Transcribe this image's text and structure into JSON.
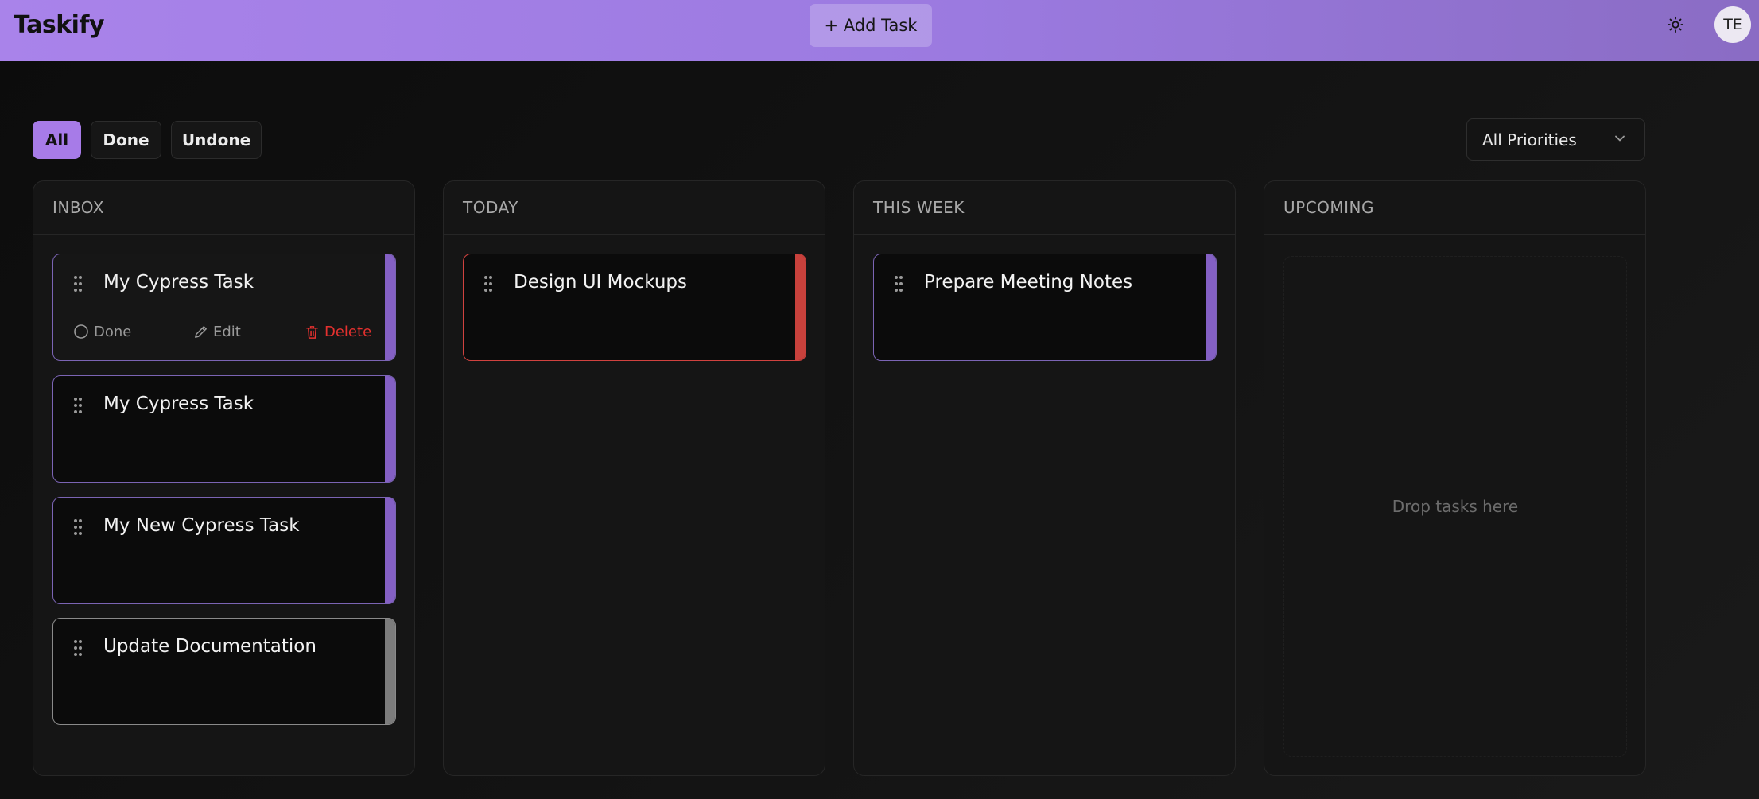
{
  "header": {
    "brand": "Taskify",
    "add_task_label": "+ Add Task",
    "avatar_initials": "TE",
    "theme_icon": "sun-icon"
  },
  "filters": {
    "items": [
      {
        "label": "All",
        "active": true
      },
      {
        "label": "Done",
        "active": false
      },
      {
        "label": "Undone",
        "active": false
      }
    ],
    "priority_select": {
      "selected": "All Priorities",
      "icon": "chevron-down-icon"
    }
  },
  "columns": [
    {
      "title": "INBOX",
      "cards": [
        {
          "title": "My Cypress Task",
          "accent": "#8460c4",
          "expanded": true,
          "actions": {
            "done": "Done",
            "edit": "Edit",
            "delete": "Delete"
          }
        },
        {
          "title": "My Cypress Task",
          "accent": "#8460c4"
        },
        {
          "title": "My New Cypress Task",
          "accent": "#8460c4"
        },
        {
          "title": "Update Documentation",
          "accent": "#7c7c7c"
        }
      ]
    },
    {
      "title": "TODAY",
      "cards": [
        {
          "title": "Design UI Mockups",
          "accent": "#c8413c"
        }
      ]
    },
    {
      "title": "THIS WEEK",
      "cards": [
        {
          "title": "Prepare Meeting Notes",
          "accent": "#8460c4"
        }
      ]
    },
    {
      "title": "UPCOMING",
      "cards": [],
      "empty_text": "Drop tasks here"
    }
  ],
  "colors": {
    "header_gradient_start": "#a983ea",
    "header_gradient_end": "#8a6cc4",
    "active_filter": "#a77be8",
    "delete": "#e5312f"
  }
}
